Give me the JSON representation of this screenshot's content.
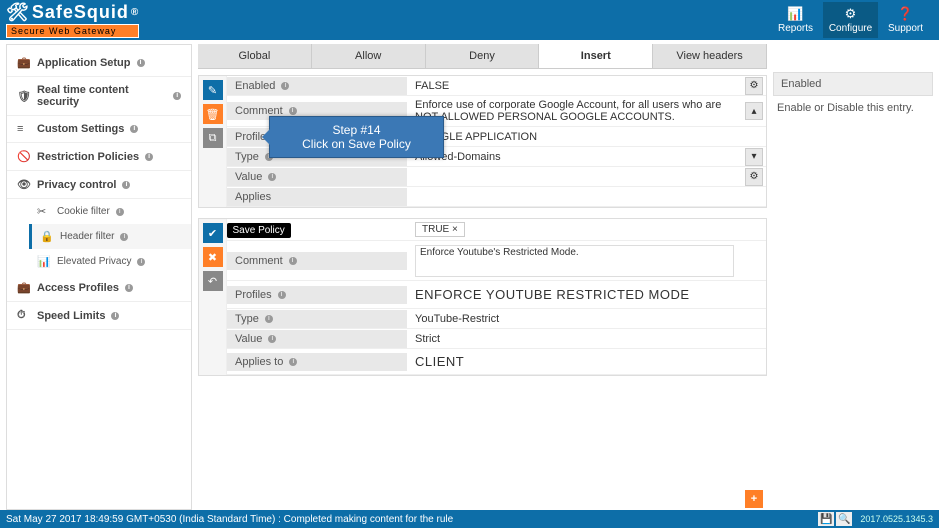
{
  "logo": {
    "name": "SafeSquid",
    "reg": "®",
    "tagline": "Secure Web Gateway"
  },
  "topnav": [
    {
      "id": "reports",
      "label": "Reports",
      "icon": "📊"
    },
    {
      "id": "configure",
      "label": "Configure",
      "icon": "⚙",
      "active": true
    },
    {
      "id": "support",
      "label": "Support",
      "icon": "❓"
    }
  ],
  "sidebar": [
    {
      "icon": "💼",
      "label": "Application Setup"
    },
    {
      "icon": "🛡",
      "label": "Real time content security"
    },
    {
      "icon": "≡",
      "label": "Custom Settings"
    },
    {
      "icon": "🚫",
      "label": "Restriction Policies"
    },
    {
      "icon": "👁",
      "label": "Privacy control",
      "open": true,
      "subs": [
        {
          "icon": "✂",
          "label": "Cookie filter"
        },
        {
          "icon": "🔒",
          "label": "Header filter",
          "active": true
        },
        {
          "icon": "📊",
          "label": "Elevated Privacy"
        }
      ]
    },
    {
      "icon": "💼",
      "label": "Access Profiles"
    },
    {
      "icon": "⏱",
      "label": "Speed Limits"
    }
  ],
  "tabs": [
    "Global",
    "Allow",
    "Deny",
    "Insert",
    "View headers"
  ],
  "active_tab": "Insert",
  "card1": {
    "rows": {
      "enabled": {
        "k": "Enabled",
        "v": "FALSE"
      },
      "comment": {
        "k": "Comment",
        "v": "Enforce use of corporate Google Account, for all users who are NOT ALLOWED PERSONAL GOOGLE ACCOUNTS."
      },
      "profiles": {
        "k": "Profiles",
        "v": "GOOGLE APPLICATION"
      },
      "type": {
        "k": "Type",
        "v": "Allowed-Domains"
      },
      "value": {
        "k": "Value",
        "v": ""
      },
      "applies": {
        "k": "Applies",
        "v": ""
      }
    }
  },
  "card2": {
    "save_tooltip": "Save Policy",
    "rows": {
      "enabled": {
        "k": "",
        "v": "TRUE"
      },
      "comment": {
        "k": "Comment",
        "v": "Enforce Youtube's Restricted Mode."
      },
      "profiles": {
        "k": "Profiles",
        "v": "ENFORCE YOUTUBE RESTRICTED MODE"
      },
      "type": {
        "k": "Type",
        "v": "YouTube-Restrict"
      },
      "value": {
        "k": "Value",
        "v": "Strict"
      },
      "applies": {
        "k": "Applies to",
        "v": "CLIENT"
      }
    }
  },
  "callout": {
    "title": "Step #14",
    "body": "Click on Save Policy"
  },
  "rightpanel": {
    "title": "Enabled",
    "desc": "Enable or Disable this entry."
  },
  "status": {
    "text": "Sat May 27 2017 18:49:59 GMT+0530 (India Standard Time) : Completed making content for the rule",
    "version": "2017.0525.1345.3"
  }
}
